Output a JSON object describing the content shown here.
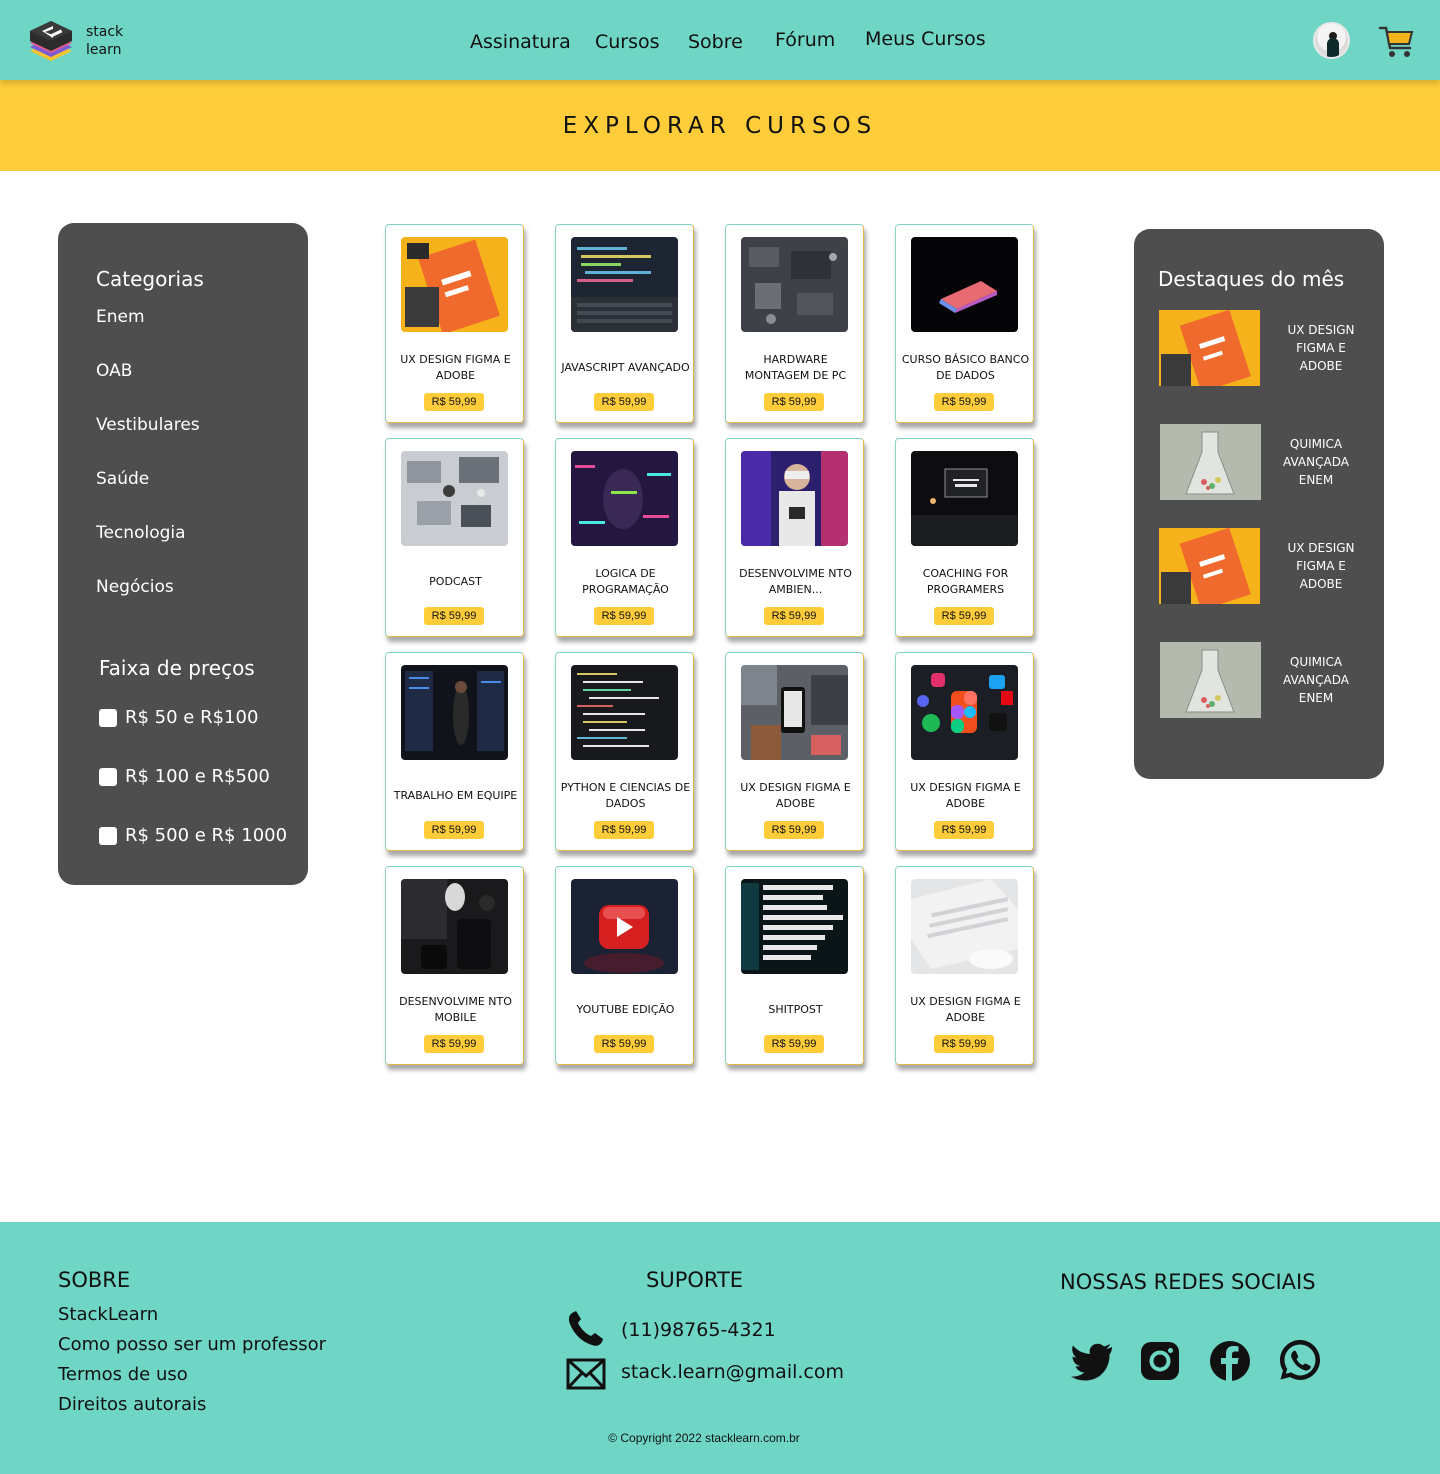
{
  "header": {
    "logo_line1": "stack",
    "logo_line2": "learn",
    "nav": [
      "Assinatura",
      "Cursos",
      "Sobre",
      "Fórum",
      "Meus Cursos"
    ],
    "icons": {
      "avatar": "user-avatar-icon",
      "cart": "cart-icon"
    }
  },
  "banner": {
    "title": "EXPLORAR CURSOS"
  },
  "sidebar": {
    "categories_heading": "Categorias",
    "categories": [
      "Enem",
      "OAB",
      "Vestibulares",
      "Saúde",
      "Tecnologia",
      "Negócios"
    ],
    "price_heading": "Faixa de preços",
    "price_ranges": [
      "R$ 50 e R$100",
      "R$ 100 e R$500",
      "R$ 500 e R$ 1000"
    ]
  },
  "courses": [
    {
      "title": "UX DESIGN FIGMA E ADOBE",
      "price": "R$ 59,99"
    },
    {
      "title": "JAVASCRIPT AVANÇADO",
      "price": "R$ 59,99"
    },
    {
      "title": "HARDWARE MONTAGEM DE PC",
      "price": "R$ 59,99"
    },
    {
      "title": "CURSO BÁSICO BANCO DE DADOS",
      "price": "R$ 59,99"
    },
    {
      "title": "PODCAST",
      "price": "R$ 59,99"
    },
    {
      "title": "LOGICA DE PROGRAMAÇÃO",
      "price": "R$ 59,99"
    },
    {
      "title": "DESENVOLVIME NTO AMBIEN...",
      "price": "R$ 59,99"
    },
    {
      "title": "COACHING FOR PROGRAMERS",
      "price": "R$ 59,99"
    },
    {
      "title": "TRABALHO EM EQUIPE",
      "price": "R$ 59,99"
    },
    {
      "title": "PYTHON E CIENCIAS DE DADOS",
      "price": "R$ 59,99"
    },
    {
      "title": "UX DESIGN FIGMA E ADOBE",
      "price": "R$ 59,99"
    },
    {
      "title": "UX DESIGN FIGMA E ADOBE",
      "price": "R$ 59,99"
    },
    {
      "title": "DESENVOLVIME NTO MOBILE",
      "price": "R$ 59,99"
    },
    {
      "title": "YOUTUBE EDIÇÃO",
      "price": "R$ 59,99"
    },
    {
      "title": "SHITPOST",
      "price": "R$ 59,99"
    },
    {
      "title": "UX DESIGN FIGMA E ADOBE",
      "price": "R$ 59,99"
    }
  ],
  "featured": {
    "heading": "Destaques do mês",
    "items": [
      "UX DESIGN FIGMA E ADOBE",
      "QUIMICA AVANÇADA ENEM",
      "UX DESIGN FIGMA E ADOBE",
      "QUIMICA AVANÇADA ENEM"
    ]
  },
  "footer": {
    "about_heading": "SOBRE",
    "about_links": [
      "StackLearn",
      "Como posso ser um professor",
      "Termos de uso",
      "Direitos autorais"
    ],
    "support_heading": "SUPORTE",
    "phone": "(11)98765-4321",
    "email": "stack.learn@gmail.com",
    "social_heading": "NOSSAS REDES SOCIAIS",
    "social_icons": [
      "twitter-icon",
      "instagram-icon",
      "facebook-icon",
      "whatsapp-icon"
    ],
    "copyright": "© Copyright 2022 stacklearn.com.br"
  },
  "colors": {
    "teal": "#6fd6c6",
    "yellow": "#fecd39",
    "panel": "#4e4e4e"
  }
}
